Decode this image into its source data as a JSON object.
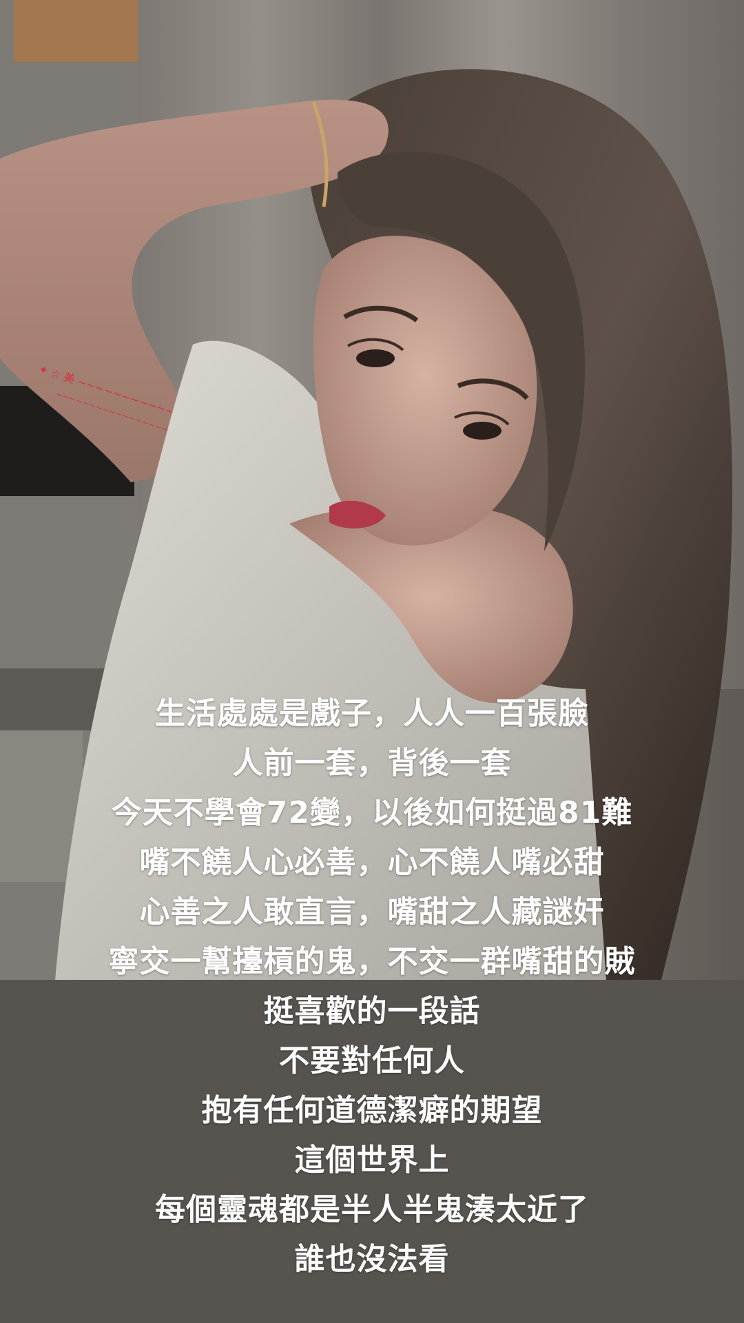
{
  "photo": {
    "tattoo_color": "#d2323c",
    "shirt_color": "#e8e6e1",
    "hair_color": "#3a3029",
    "background_curtain_color": "#8a857f"
  },
  "caption": {
    "lines": [
      "生活處處是戲子，人人一百張臉",
      "人前一套，背後一套",
      "今天不學會72變，以後如何挺過81難",
      "嘴不饒人心必善，心不饒人嘴必甜",
      "心善之人敢直言，嘴甜之人藏謎奸",
      "寧交一幫擡槓的鬼，不交一群嘴甜的賊",
      "挺喜歡的一段話",
      "不要對任何人",
      "抱有任何道德潔癖的期望",
      "這個世界上",
      "每個靈魂都是半人半鬼湊太近了",
      "誰也沒法看"
    ]
  },
  "panel": {
    "background_color": "#57534f"
  }
}
